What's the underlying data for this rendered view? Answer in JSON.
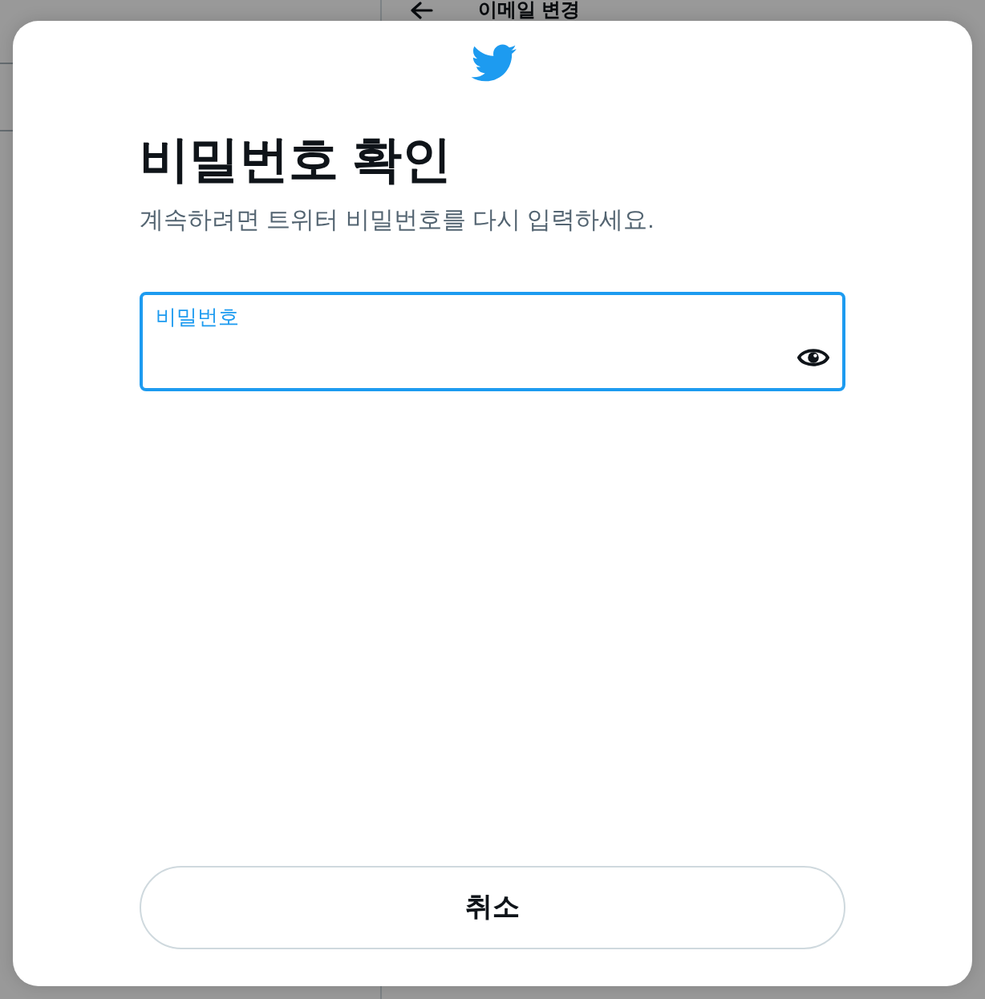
{
  "background_page": {
    "title": "이메일 변경"
  },
  "dialog": {
    "title": "비밀번호 확인",
    "subtitle": "계속하려면 트위터 비밀번호를 다시 입력하세요.",
    "password_field": {
      "label": "비밀번호",
      "focused": true
    },
    "cancel_button": {
      "label": "취소"
    }
  }
}
